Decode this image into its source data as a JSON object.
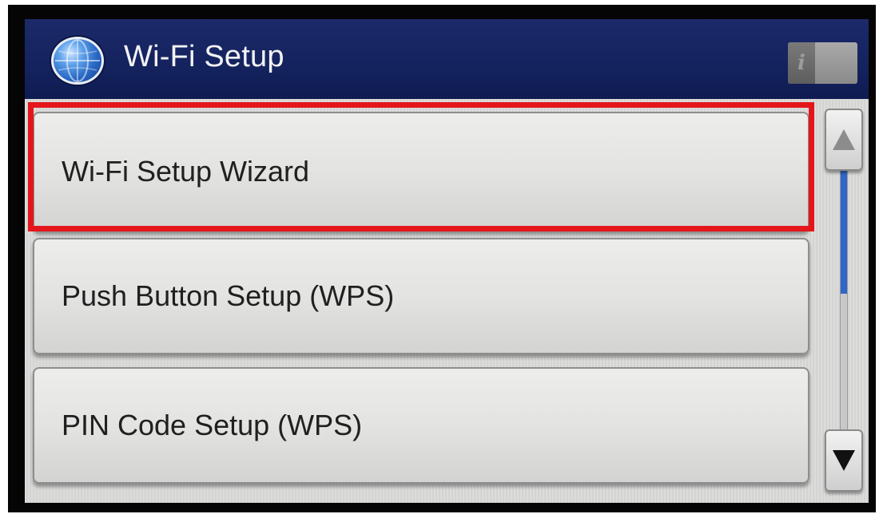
{
  "header": {
    "title": "Wi-Fi Setup",
    "icon": "globe-icon",
    "info_button_glyph": "i"
  },
  "menu": {
    "items": [
      {
        "label": "Wi-Fi Setup Wizard",
        "highlighted": true
      },
      {
        "label": "Push Button Setup (WPS)",
        "highlighted": false
      },
      {
        "label": "PIN Code Setup (WPS)",
        "highlighted": false
      }
    ]
  },
  "scrollbar": {
    "up_icon": "arrow-up-icon",
    "down_icon": "arrow-down-icon",
    "up_enabled": false,
    "down_enabled": true
  },
  "colors": {
    "header_bg": "#14225e",
    "highlight_border": "#e4161c",
    "scroll_thumb": "#2f66c8"
  }
}
